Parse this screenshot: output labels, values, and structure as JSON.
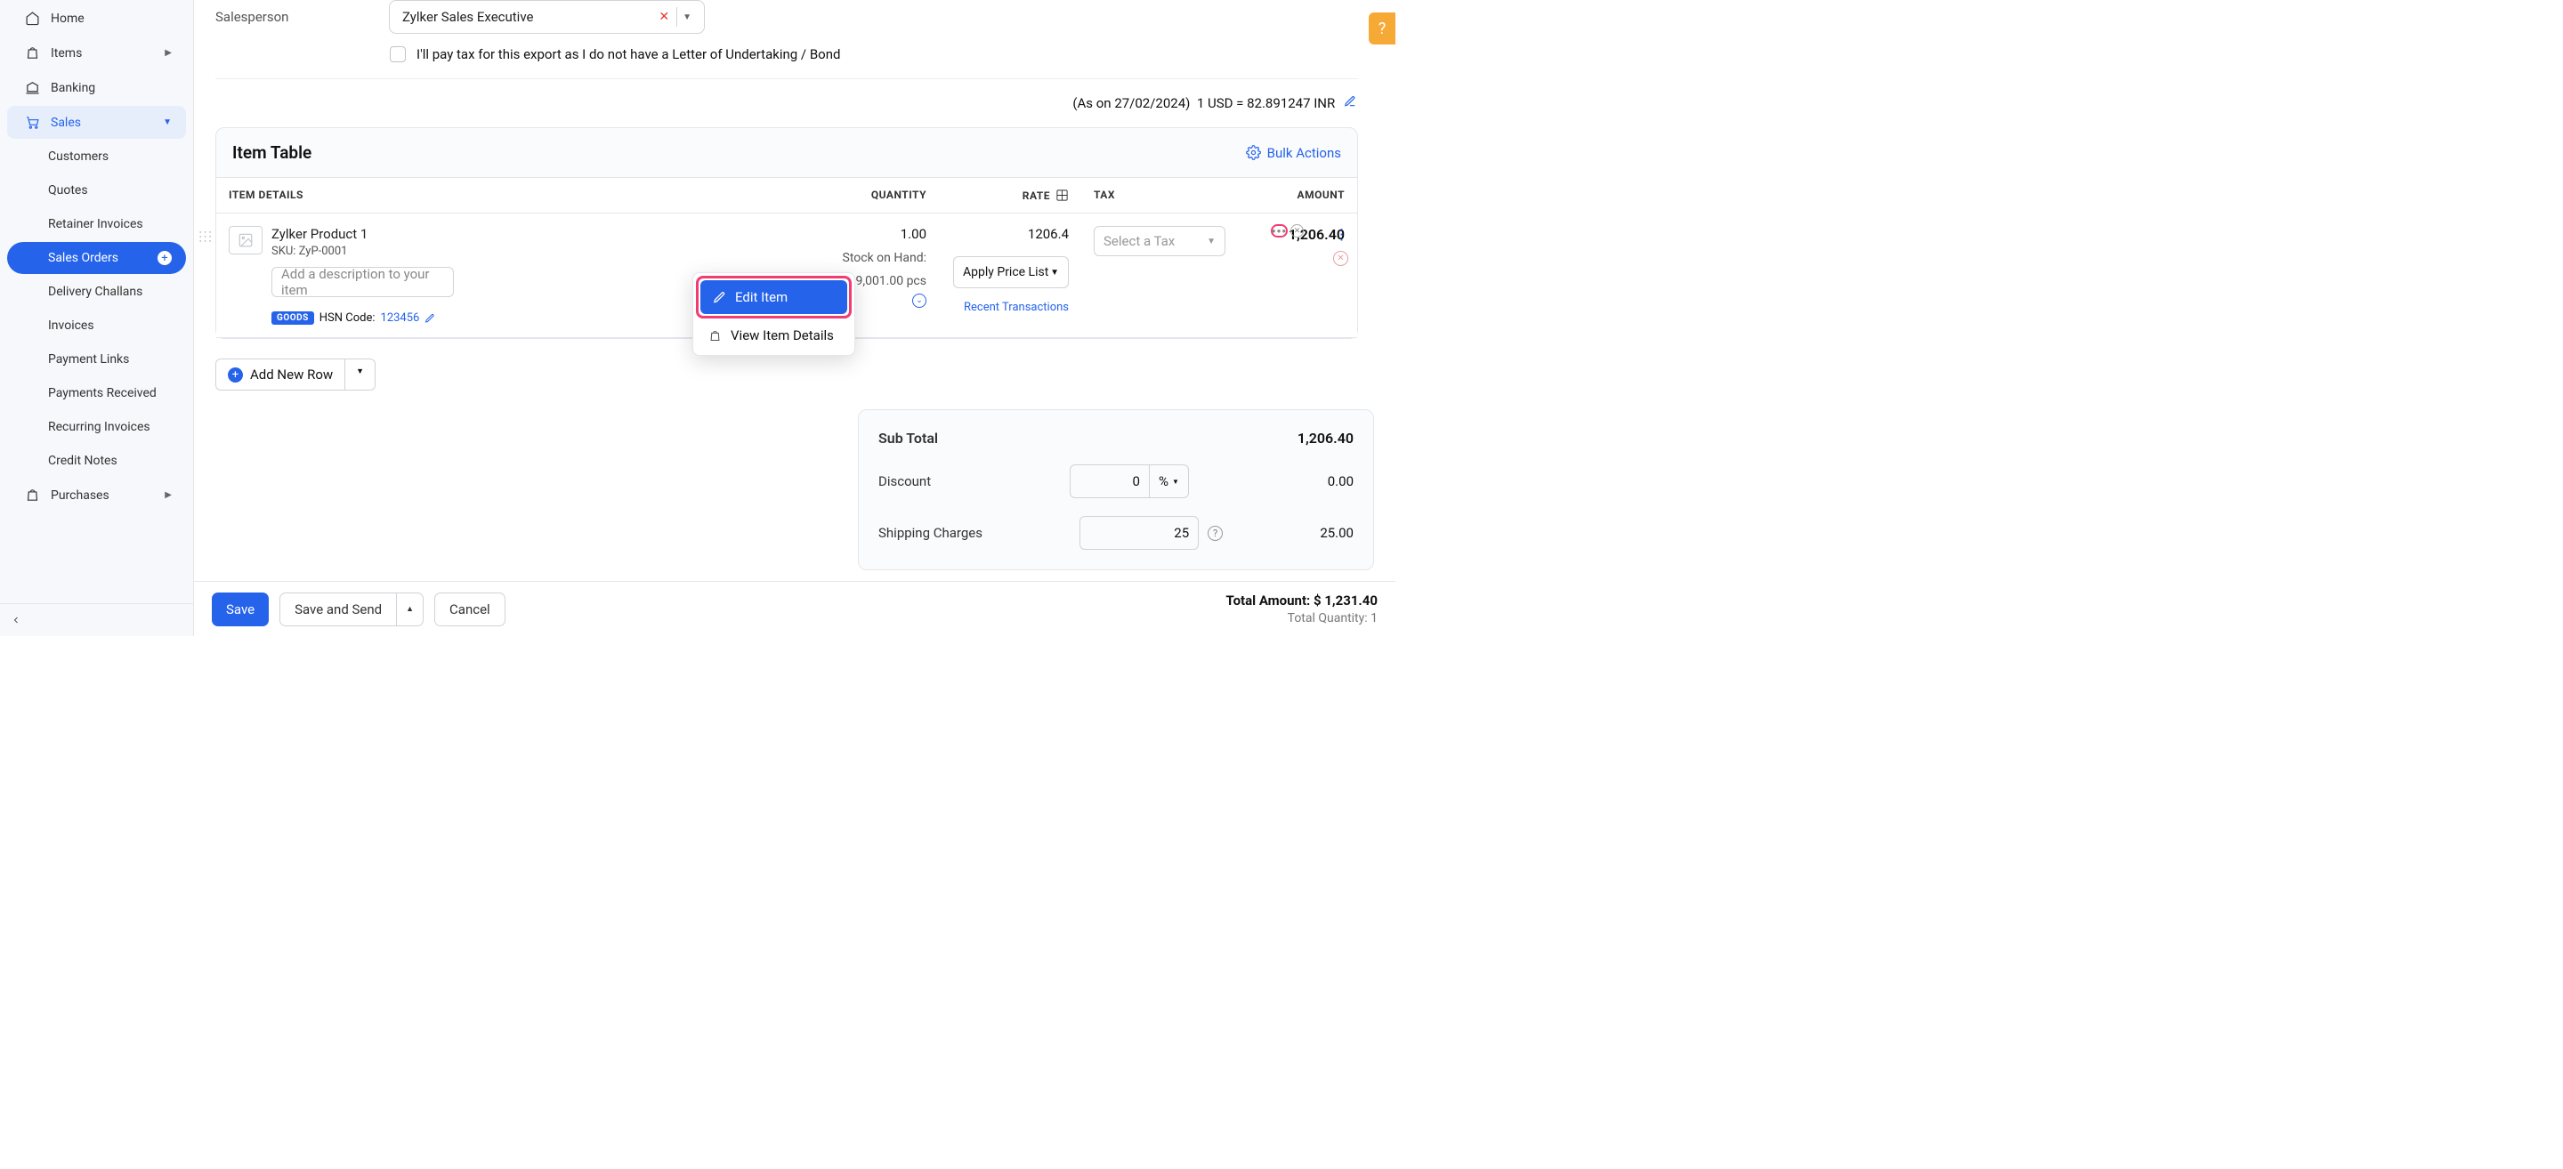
{
  "sidebar": {
    "home": "Home",
    "items": "Items",
    "banking": "Banking",
    "sales": "Sales",
    "sales_children": {
      "customers": "Customers",
      "quotes": "Quotes",
      "retainer": "Retainer Invoices",
      "sales_orders": "Sales Orders",
      "delivery": "Delivery Challans",
      "invoices": "Invoices",
      "payment_links": "Payment Links",
      "payments_rec": "Payments Received",
      "recurring": "Recurring Invoices",
      "credit_notes": "Credit Notes"
    },
    "purchases": "Purchases"
  },
  "form": {
    "salesperson_label": "Salesperson",
    "salesperson_value": "Zylker Sales Executive",
    "export_tax_label": "I'll pay tax for this export as I do not have a Letter of Undertaking / Bond",
    "fx_date": "(As on 27/02/2024)",
    "fx_rate": "1 USD = 82.891247 INR"
  },
  "table": {
    "title": "Item Table",
    "bulk": "Bulk Actions",
    "hdr_details": "ITEM DETAILS",
    "hdr_qty": "QUANTITY",
    "hdr_rate": "RATE",
    "hdr_tax": "TAX",
    "hdr_amount": "AMOUNT",
    "row": {
      "name": "Zylker Product 1",
      "sku": "SKU: ZyP-0001",
      "desc_ph": "Add a description to your item",
      "goods_badge": "GOODS",
      "hsn_label": "HSN Code:",
      "hsn_val": "123456",
      "qty": "1.00",
      "stock_label": "Stock on Hand:",
      "stock_val": "99,001.00 pcs",
      "rate": "1206.4",
      "price_list": "Apply Price List",
      "recent_tx": "Recent Transactions",
      "tax_ph": "Select a Tax",
      "amount": "1,206.40"
    },
    "add_row": "Add New Row"
  },
  "popup": {
    "edit": "Edit Item",
    "view": "View Item Details"
  },
  "summary": {
    "subtotal_label": "Sub Total",
    "subtotal_val": "1,206.40",
    "discount_label": "Discount",
    "discount_input": "0",
    "discount_unit": "%",
    "discount_val": "0.00",
    "ship_label": "Shipping Charges",
    "ship_input": "25",
    "ship_val": "25.00"
  },
  "footer": {
    "save": "Save",
    "save_send": "Save and Send",
    "cancel": "Cancel",
    "total_amount_label": "Total Amount: ",
    "total_amount_val": "$ 1,231.40",
    "total_qty_label": "Total Quantity: ",
    "total_qty_val": "1"
  }
}
